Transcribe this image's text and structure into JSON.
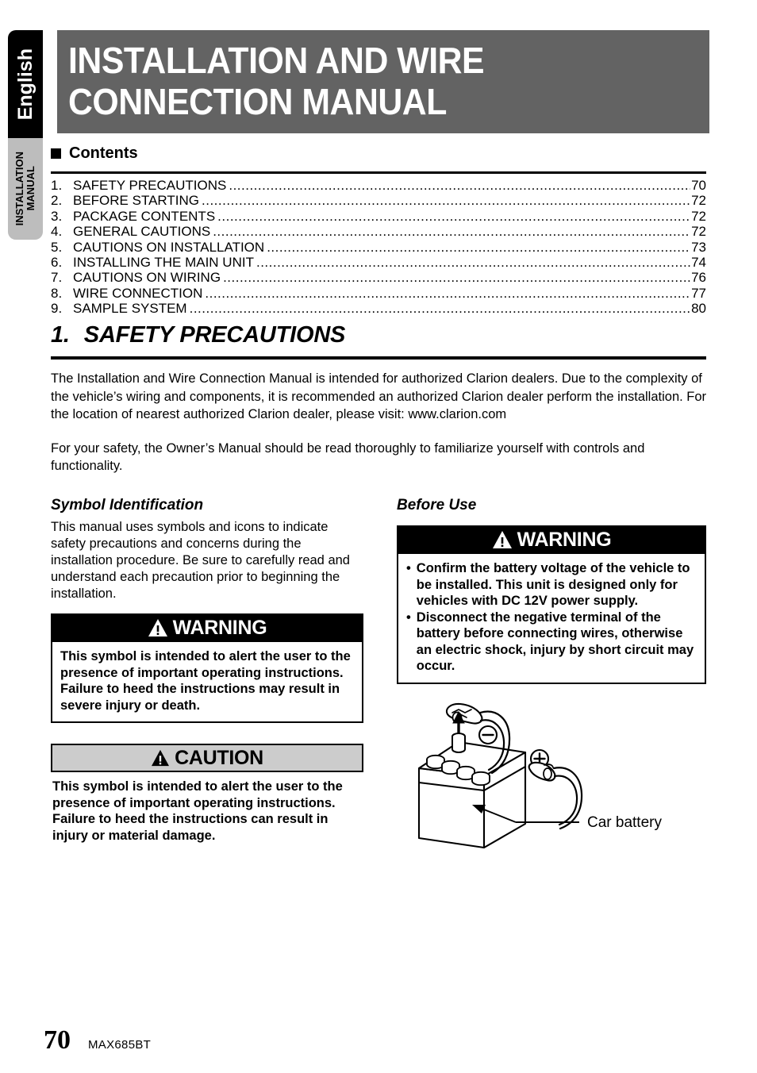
{
  "side_tabs": {
    "language_tab": "English",
    "manual_tab_line1": "INSTALLATION",
    "manual_tab_line2": "MANUAL"
  },
  "header": {
    "title_line1": "INSTALLATION AND WIRE",
    "title_line2": "CONNECTION MANUAL",
    "banner_color": "#636363"
  },
  "contents": {
    "heading": "Contents",
    "items": [
      {
        "num": "1.",
        "title": "SAFETY PRECAUTIONS",
        "page": "70"
      },
      {
        "num": "2.",
        "title": "BEFORE STARTING",
        "page": "72"
      },
      {
        "num": "3.",
        "title": "PACKAGE CONTENTS",
        "page": "72"
      },
      {
        "num": "4.",
        "title": "GENERAL CAUTIONS",
        "page": "72"
      },
      {
        "num": "5.",
        "title": "CAUTIONS ON INSTALLATION",
        "page": "73"
      },
      {
        "num": "6.",
        "title": "INSTALLING THE MAIN UNIT",
        "page": "74"
      },
      {
        "num": "7.",
        "title": "CAUTIONS ON WIRING",
        "page": "76"
      },
      {
        "num": "8.",
        "title": "WIRE CONNECTION",
        "page": "77"
      },
      {
        "num": "9.",
        "title": "SAMPLE SYSTEM",
        "page": "80"
      }
    ]
  },
  "section": {
    "number": "1.",
    "title": "SAFETY PRECAUTIONS",
    "paragraph1": "The Installation and Wire Connection Manual is intended for authorized Clarion dealers. Due to the complexity of the vehicle’s wiring and components, it is recommended an authorized Clarion dealer perform the installation.  For the location of nearest authorized Clarion dealer, please visit: www.clarion.com",
    "paragraph2": "For your safety, the Owner’s Manual should be read thoroughly to familiarize yourself with controls and functionality."
  },
  "symbol_identification": {
    "heading": "Symbol Identification",
    "body": "This manual uses symbols and icons to indicate safety precautions and concerns during the installation procedure.  Be sure to carefully read and understand each precaution prior to beginning the installation.",
    "warning": {
      "label": "WARNING",
      "text": "This symbol is intended to alert the user to the presence of important operating instructions. Failure to heed the instructions may result in severe injury or death.",
      "header_bg": "#000000",
      "header_fg": "#ffffff"
    },
    "caution": {
      "label": "CAUTION",
      "text": "This symbol is intended to alert the user to the presence of important operating instructions. Failure to heed the instructions can result in injury or material damage.",
      "header_bg": "#cccccc",
      "header_fg": "#000000"
    }
  },
  "before_use": {
    "heading": "Before Use",
    "warning": {
      "label": "WARNING",
      "bullet_char": "•",
      "bullets": [
        "Confirm the battery voltage of the vehicle to be installed. This unit is designed only for vehicles with DC 12V power supply.",
        "Disconnect the negative terminal of the battery before connecting wires, otherwise an electric shock, injury by short circuit may occur."
      ]
    },
    "figure": {
      "caption": "Car battery",
      "negative_symbol": "−",
      "positive_symbol": "+"
    }
  },
  "footer": {
    "page_number": "70",
    "model": "MAX685BT"
  }
}
